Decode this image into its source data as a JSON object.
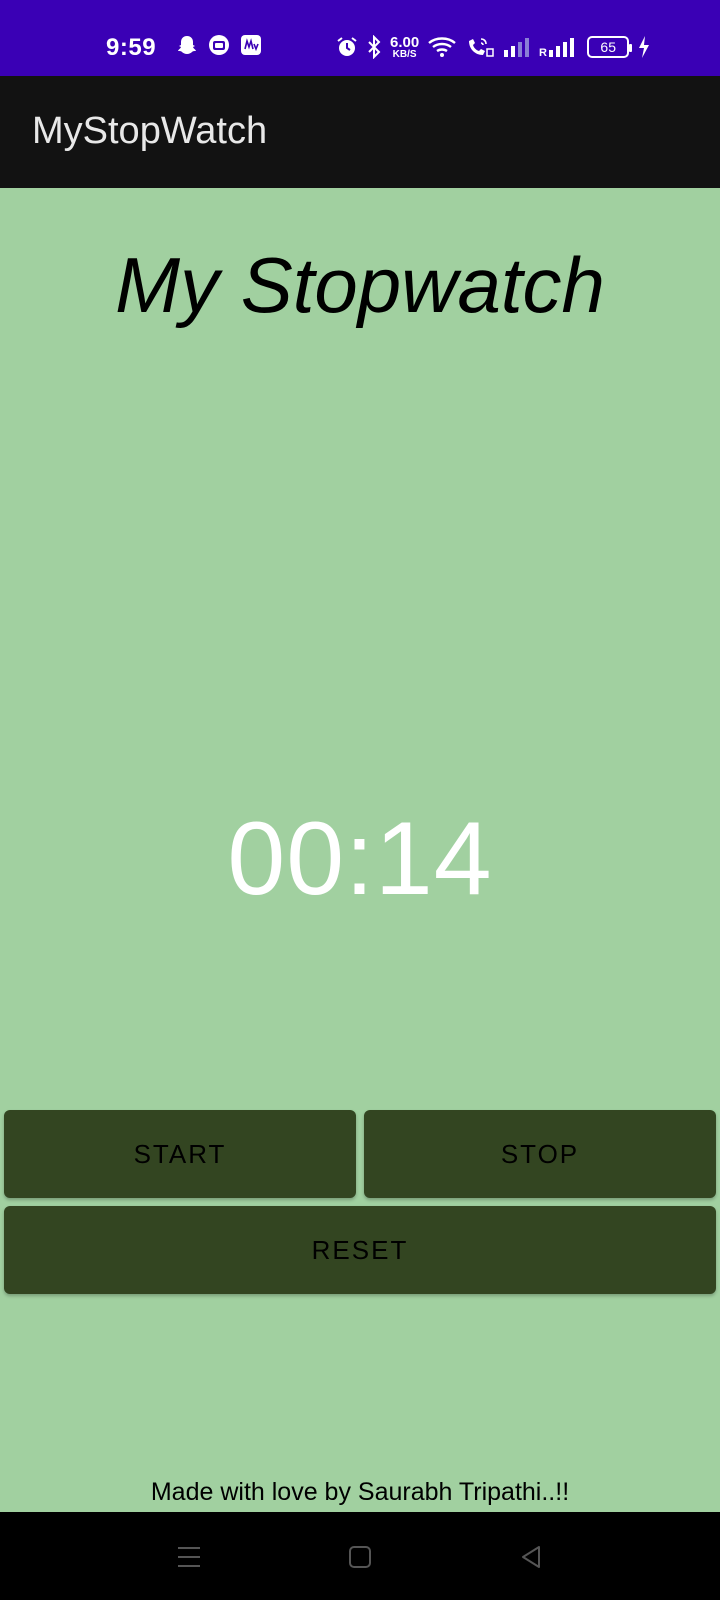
{
  "status_bar": {
    "time": "9:59",
    "net_speed_value": "6.00",
    "net_speed_unit": "KB/S",
    "battery_level": "65",
    "icons": [
      "snapchat-icon",
      "wallet-icon",
      "my-app-icon",
      "alarm-icon",
      "bluetooth-icon",
      "wifi-icon",
      "wifi-calling-icon",
      "signal-icon",
      "signal-roaming-icon",
      "battery-icon",
      "charging-icon"
    ],
    "background": "#3a00b5"
  },
  "app_bar": {
    "title": "MyStopWatch",
    "background": "#121212"
  },
  "main": {
    "heading": "My Stopwatch",
    "timer": "00:14",
    "background": "#a1d0a0"
  },
  "buttons": {
    "start_label": "START",
    "stop_label": "STOP",
    "reset_label": "RESET",
    "color": "#334521"
  },
  "footer": {
    "text": "Made with love by Saurabh Tripathi..!!"
  },
  "nav_bar": {
    "icons": [
      "menu-icon",
      "home-icon",
      "back-icon"
    ]
  }
}
